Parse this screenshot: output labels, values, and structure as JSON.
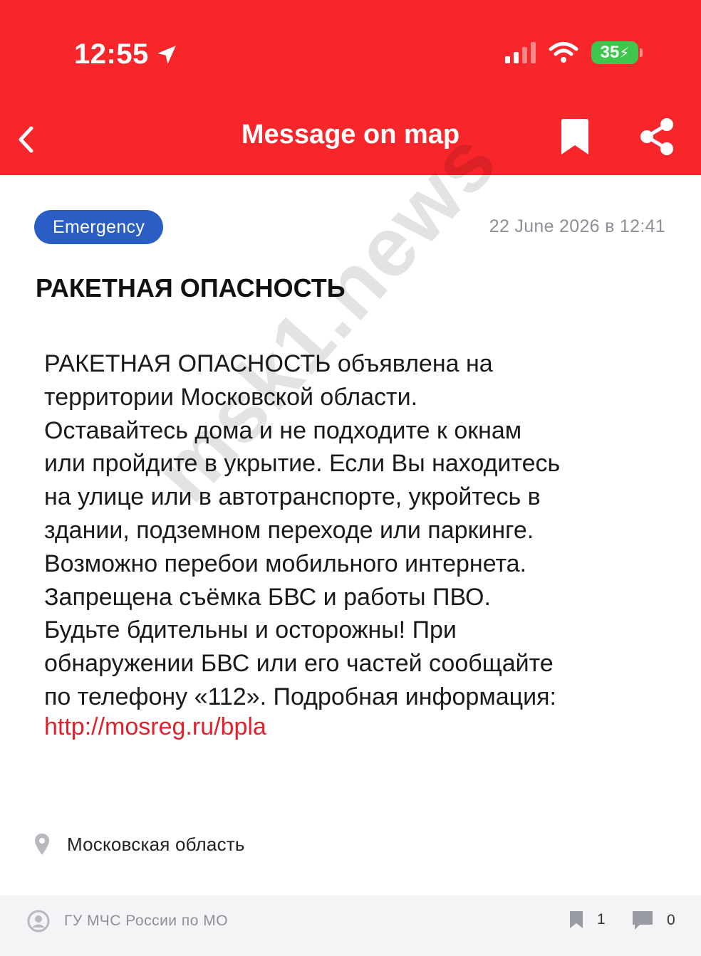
{
  "status_bar": {
    "time": "12:55",
    "battery": "35"
  },
  "nav": {
    "title": "Message on map"
  },
  "message": {
    "category": "Emergency",
    "date": "22 June 2026 в 12:41",
    "title": "РАКЕТНАЯ ОПАСНОСТЬ",
    "body_lines": [
      "РАКЕТНАЯ ОПАСНОСТЬ объявлена на",
      "территории Московской области.",
      "Оставайтесь дома и не подходите к окнам",
      "или пройдите в укрытие. Если Вы находитесь",
      "на улице или в автотранспорте, укройтесь в",
      "здании, подземном переходе или паркинге.",
      "Возможно перебои мобильного интернета.",
      "Запрещена съёмка БВС и работы ПВО.",
      "Будьте бдительны и осторожны! При",
      "обнаружении БВС или его частей сообщайте",
      "по телефону «112». Подробная информация:"
    ],
    "link": "http://mosreg.ru/bpla",
    "location": "Московская область"
  },
  "watermark": "msk1.news",
  "footer": {
    "author": "ГУ МЧС России по МО",
    "bookmarks_count": "1",
    "comments_count": "0"
  },
  "colors": {
    "header": "#f6262a",
    "tag": "#2b5ec4",
    "link": "#e0202a"
  }
}
